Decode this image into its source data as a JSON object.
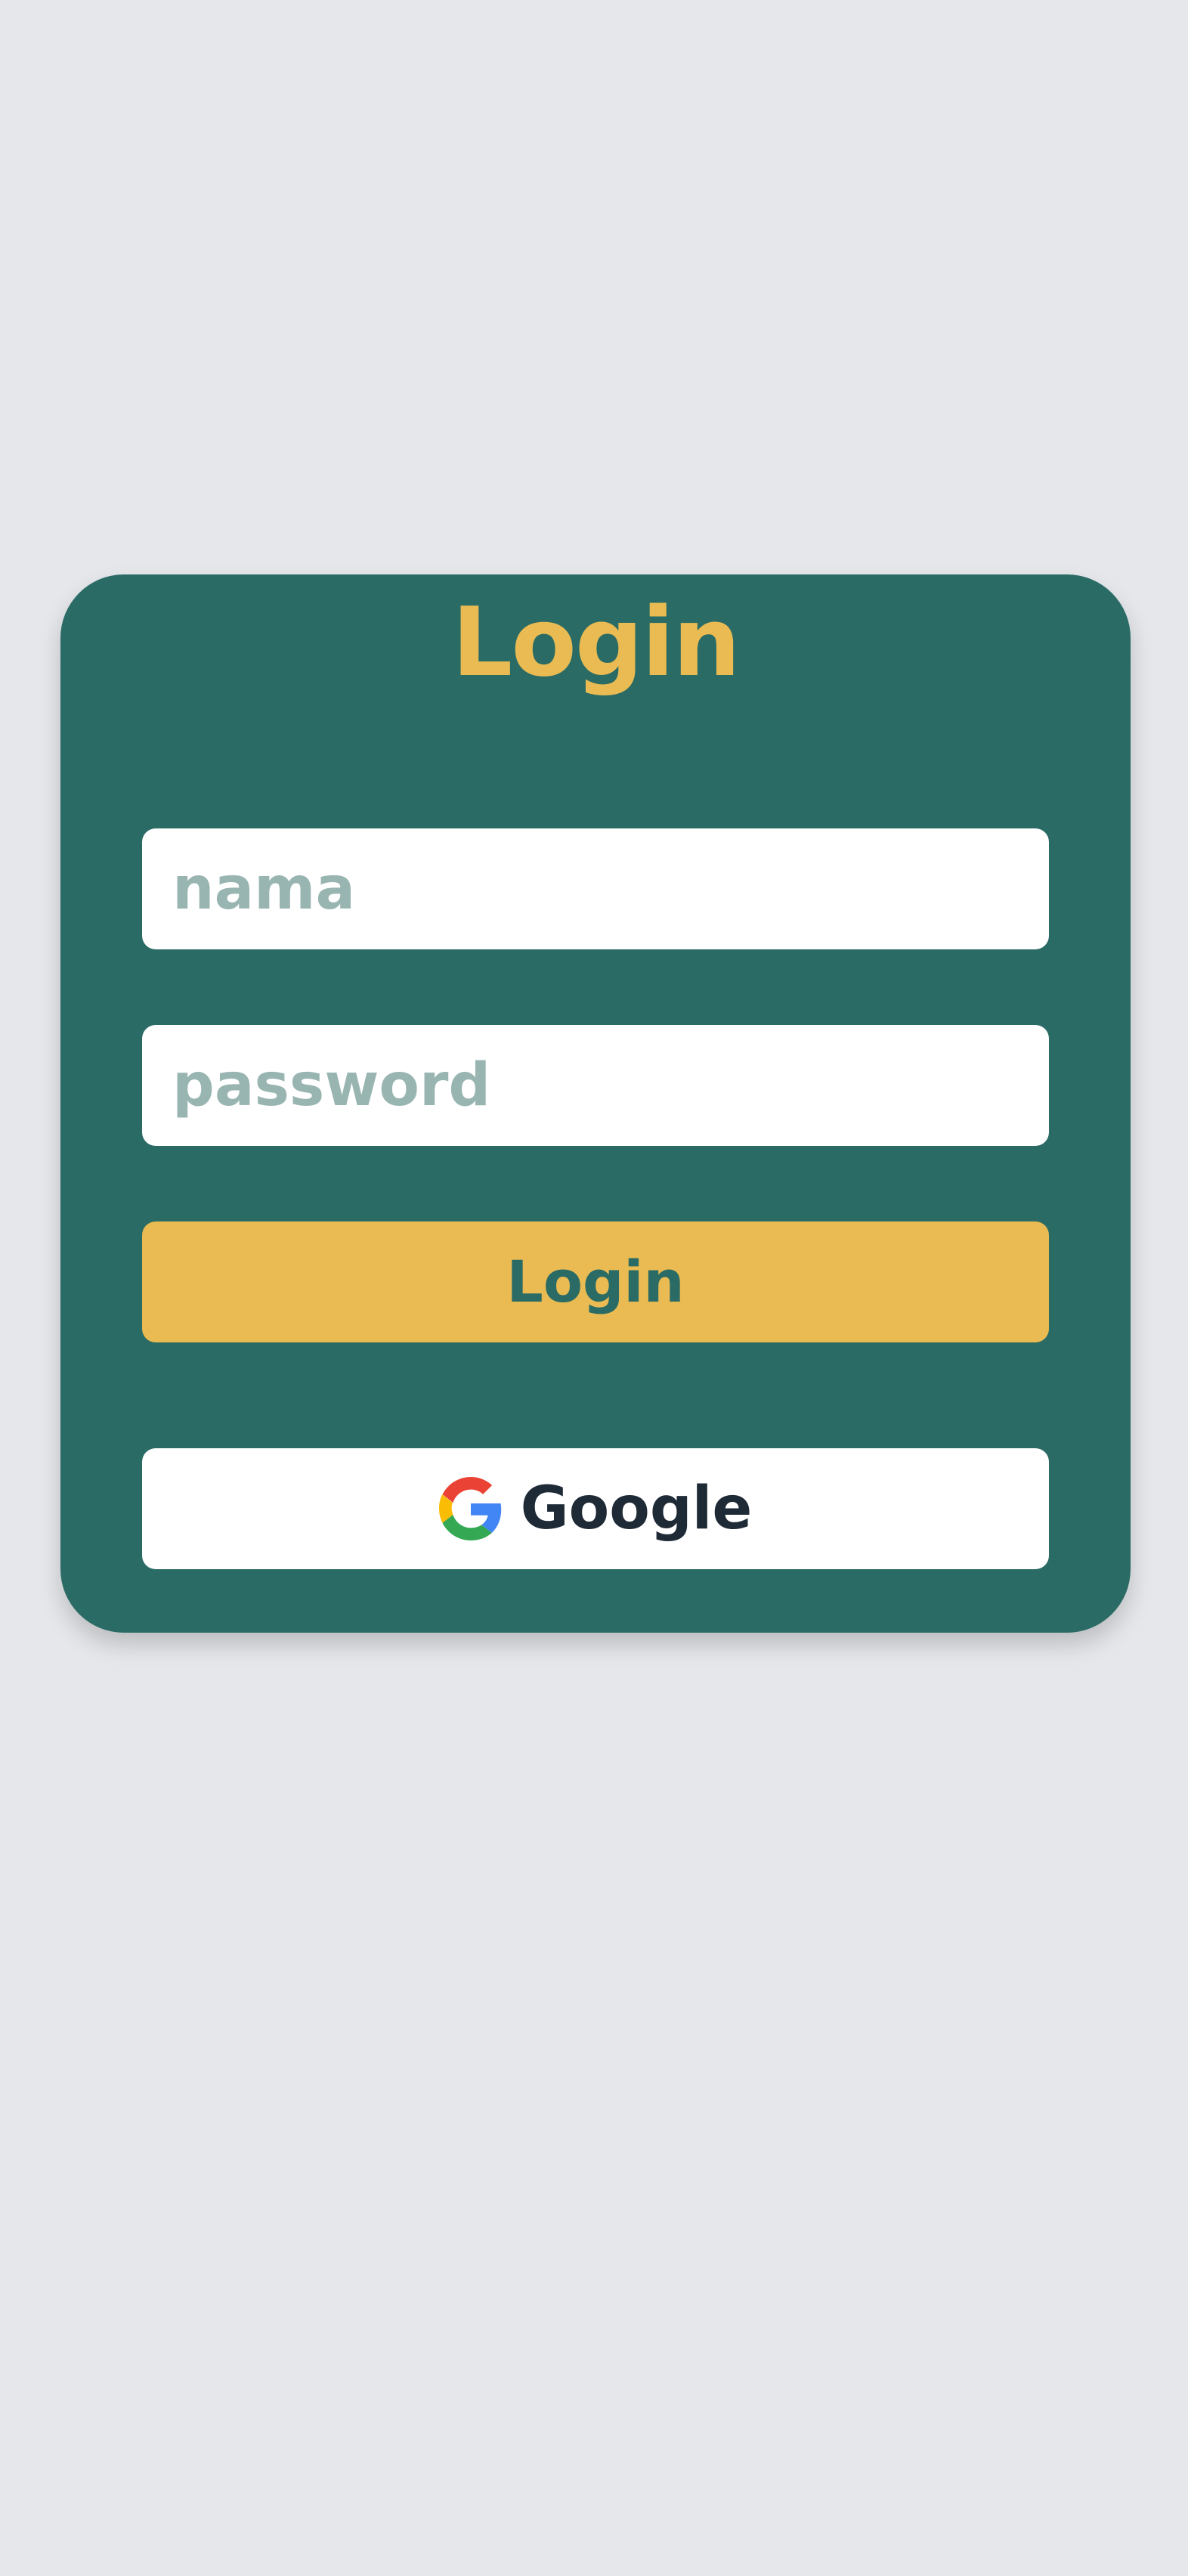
{
  "title": "Login",
  "form": {
    "name_placeholder": "nama",
    "name_value": "",
    "password_placeholder": "password",
    "password_value": "",
    "login_label": "Login",
    "google_label": "Google"
  },
  "icons": {
    "google": "google-g-icon"
  },
  "colors": {
    "background": "#e5e7eb",
    "card": "#2b6b65",
    "accent": "#e9bb52",
    "placeholder": "#99b5b1",
    "dark_text": "#1f2a37"
  }
}
